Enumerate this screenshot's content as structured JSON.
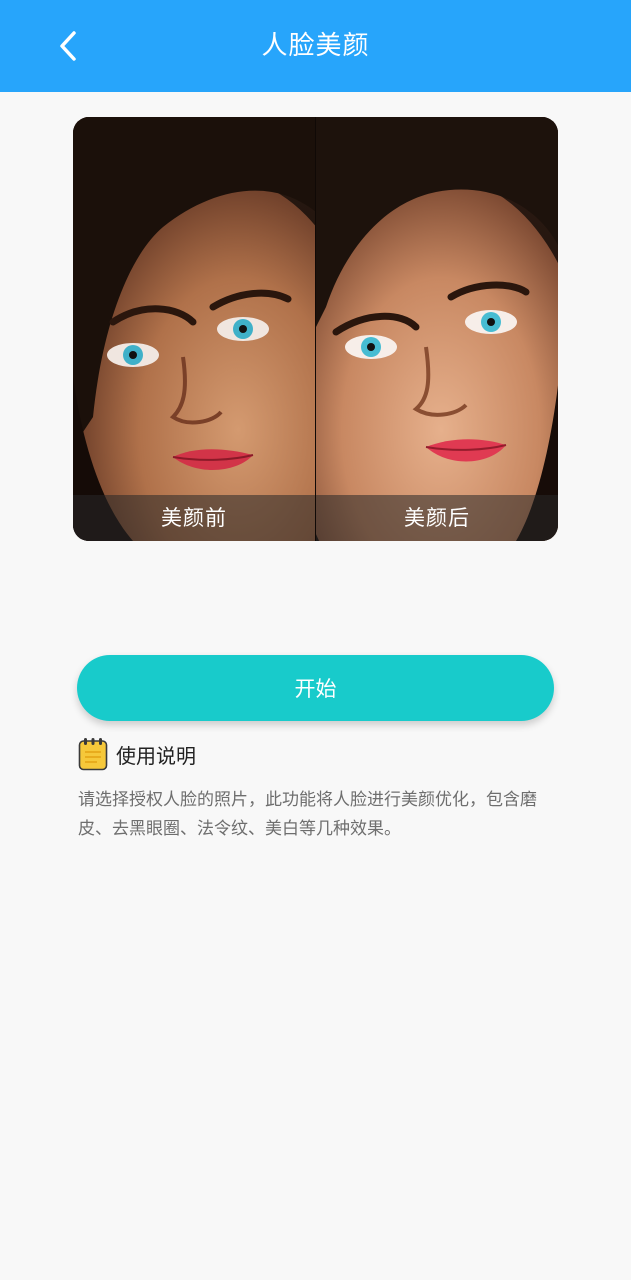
{
  "header": {
    "title": "人脸美颜"
  },
  "compare": {
    "before_label": "美颜前",
    "after_label": "美颜后"
  },
  "actions": {
    "start_label": "开始"
  },
  "guide": {
    "title": "使用说明",
    "text": "请选择授权人脸的照片，此功能将人脸进行美颜优化，包含磨皮、去黑眼圈、法令纹、美白等几种效果。"
  },
  "colors": {
    "header_bg": "#27a5fb",
    "start_button": "#18cbcb",
    "page_bg": "#f8f8f8"
  },
  "icons": {
    "back": "chevron-left-icon",
    "guide": "notepad-icon"
  }
}
